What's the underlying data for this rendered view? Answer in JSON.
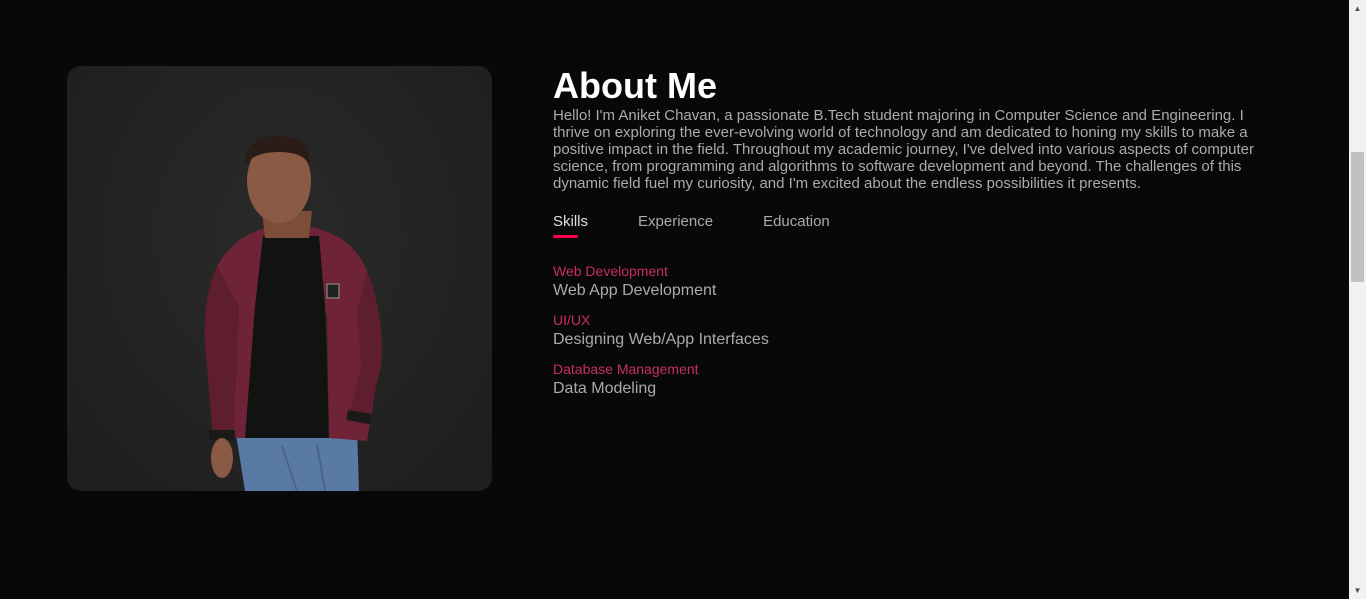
{
  "about": {
    "title": "About Me",
    "paragraph": "Hello! I'm Aniket Chavan, a passionate B.Tech student majoring in Computer Science and Engineering. I thrive on exploring the ever-evolving world of technology and am dedicated to honing my skills to make a positive impact in the field. Throughout my academic journey, I've delved into various aspects of computer science, from programming and algorithms to software development and beyond. The challenges of this dynamic field fuel my curiosity, and I'm excited about the endless possibilities it presents."
  },
  "tabs": [
    {
      "label": "Skills",
      "active": true
    },
    {
      "label": "Experience",
      "active": false
    },
    {
      "label": "Education",
      "active": false
    }
  ],
  "skills": [
    {
      "category": "Web Development",
      "detail": "Web App Development"
    },
    {
      "category": "UI/UX",
      "detail": "Designing Web/App Interfaces"
    },
    {
      "category": "Database Management",
      "detail": "Data Modeling"
    }
  ],
  "profile_photo": {
    "icon": "profile-photo"
  },
  "colors": {
    "background": "#080808",
    "accent": "#ff004f",
    "category_text": "#c6305c",
    "body_text": "#ababab"
  },
  "scrollbar": {
    "up_icon": "▲",
    "down_icon": "▼"
  }
}
